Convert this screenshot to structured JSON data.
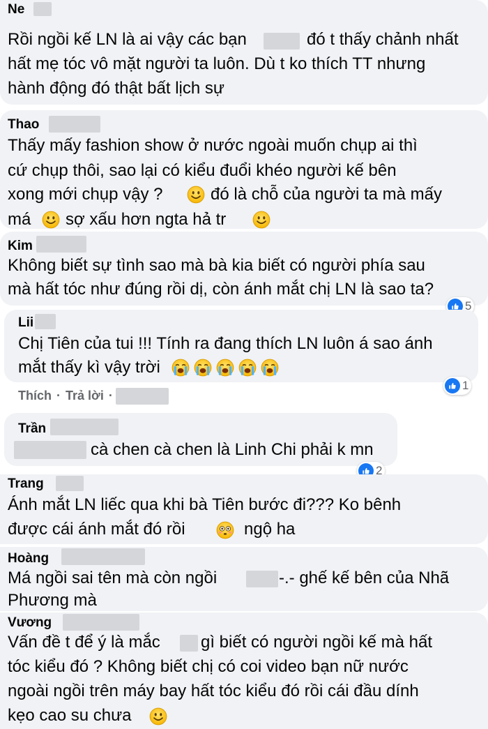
{
  "comments": [
    {
      "name": "Ne",
      "lines": [
        "Rồi ngồi kế LN là ai vậy các bạn",
        "đó t thấy chảnh nhất",
        "hất mẹ tóc vô mặt người ta luôn. Dù t ko thích TT nhưng",
        "hành động đó thật bất lịch sự"
      ]
    },
    {
      "name": "Thao",
      "lines": [
        "Thấy mấy fashion show ở nước ngoài muốn chụp ai thì",
        "cứ chụp thôi, sao lại có kiểu đuổi khéo người kế bên",
        "xong mới chụp vậy ?",
        "đó là chỗ của người ta mà mấy",
        "má",
        "sợ xấu hơn ngta hả tr"
      ]
    },
    {
      "name": "Kim",
      "lines": [
        "Không biết sự tình sao mà bà kia biết có người phía sau",
        "mà hất tóc như đúng rồi dị, còn ánh mắt chị LN là sao ta?"
      ],
      "reactions": "5"
    },
    {
      "name": "Lii",
      "lines": [
        "Chị Tiên của tui !!! Tính ra đang thích LN luôn á sao ánh",
        "mắt thấy kì vậy trời"
      ],
      "reactions": "1"
    },
    {
      "name": "Trần",
      "lines": [
        "cà chen cà chen là Linh Chi phải k mn"
      ],
      "reactions": "2"
    },
    {
      "name": "Trang",
      "lines": [
        "Ánh mắt LN liếc qua khi bà Tiên bước đi??? Ko bênh",
        "được cái ánh mắt đó rồi",
        "ngộ ha"
      ]
    },
    {
      "name": "Hoàng",
      "lines": [
        "Má ngồi sai tên mà còn ngồi",
        "-.- ghế kế bên của Nhã",
        "Phương mà"
      ]
    },
    {
      "name": "Vương",
      "lines": [
        "Vấn đề t để ý là mắc",
        "gì biết có người ngồi kế mà hất",
        "tóc kiểu đó ? Không biết chị có coi video bạn nữ nước",
        "ngoài ngồi trên máy bay hất tóc kiểu đó rồi cái đầu dính",
        "kẹo cao su chưa"
      ]
    }
  ],
  "actions": {
    "like": "Thích",
    "dot": "·",
    "reply": "Trả lời",
    "dot2": "·"
  },
  "icons": {
    "smile": "smile-emoji",
    "cry": "crying-emoji",
    "flushed": "flushed-emoji",
    "like": "like-icon"
  },
  "colors": {
    "bubble": "#f0f2f5",
    "like_blue": "#1877f2",
    "secondary_text": "#65676b"
  }
}
